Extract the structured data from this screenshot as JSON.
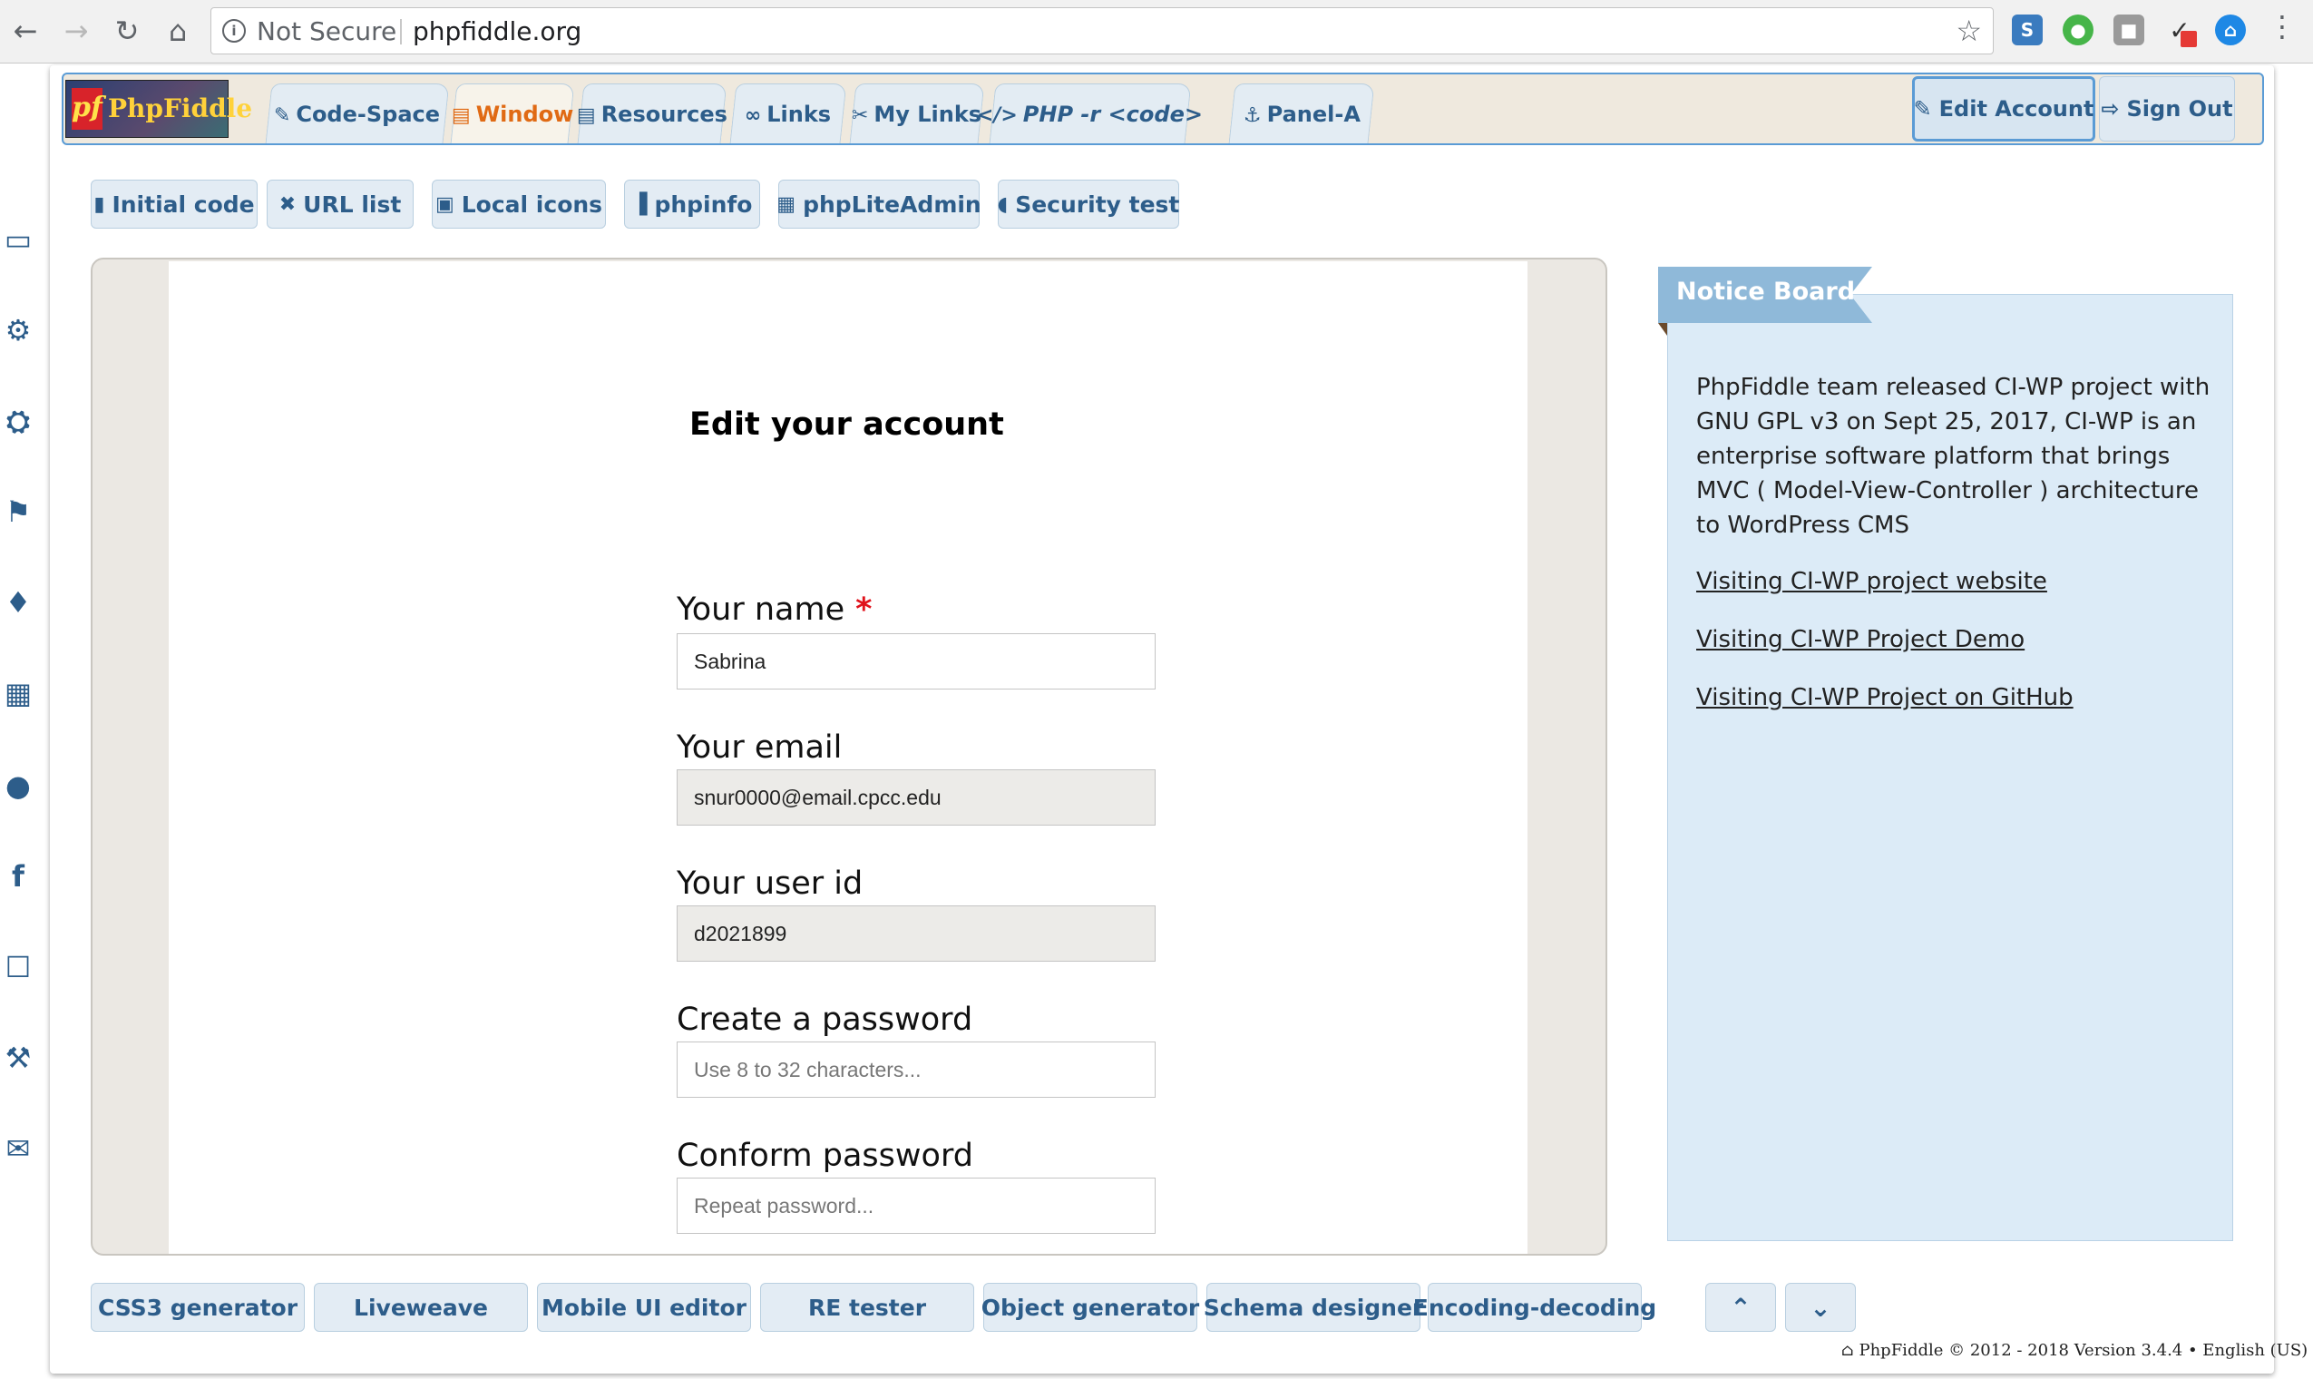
{
  "browser": {
    "security": "Not Secure",
    "url": "phpfiddle.org"
  },
  "logo": {
    "badge": "pf",
    "text": "PhpFiddle"
  },
  "tabs": [
    {
      "label": "Code-Space",
      "icon": "✎"
    },
    {
      "label": "Window",
      "icon": "▤"
    },
    {
      "label": "Resources",
      "icon": "▤"
    },
    {
      "label": "Links",
      "icon": "∞"
    },
    {
      "label": "My Links",
      "icon": "✂"
    },
    {
      "label": "PHP -r <code>",
      "icon": "</>"
    },
    {
      "label": "Panel-A",
      "icon": "⚓"
    }
  ],
  "account": {
    "edit": "Edit Account",
    "signout": "Sign Out"
  },
  "tools": [
    {
      "label": "Initial code",
      "icon": "▮"
    },
    {
      "label": "URL list",
      "icon": "✖"
    },
    {
      "label": "Local icons",
      "icon": "▣"
    },
    {
      "label": "phpinfo",
      "icon": "▐"
    },
    {
      "label": "phpLiteAdmin",
      "icon": "▦"
    },
    {
      "label": "Security test",
      "icon": "◖"
    }
  ],
  "form": {
    "title": "Edit your account",
    "name_label": "Your name",
    "required_mark": "*",
    "name_value": "Sabrina",
    "email_label": "Your email",
    "email_value": "snur0000@email.cpcc.edu",
    "userid_label": "Your user id",
    "userid_value": "d2021899",
    "password_label": "Create a password",
    "password_placeholder": "Use 8 to 32 characters...",
    "confirm_label": "Conform password",
    "confirm_placeholder": "Repeat password..."
  },
  "notice": {
    "title": "Notice Board",
    "text": "PhpFiddle team released CI-WP project with GNU GPL v3 on Sept 25, 2017, CI-WP is an enterprise software platform that brings MVC ( Model-View-Controller ) architecture to WordPress CMS",
    "links": [
      "Visiting CI-WP project website",
      "Visiting CI-WP Project Demo",
      "Visiting CI-WP Project on GitHub"
    ]
  },
  "bottom": [
    "CSS3 generator",
    "Liveweave",
    "Mobile UI editor",
    "RE tester",
    "Object generator",
    "Schema designer",
    "Encoding-decoding"
  ],
  "footer": "⌂ PhpFiddle © 2012 - 2018 Version 3.4.4 • English (US)",
  "colors": {
    "accent": "#2d5d8a",
    "active_tab": "#e06a14",
    "notice_ribbon": "#8fb9d9",
    "required": "#e0121b"
  }
}
